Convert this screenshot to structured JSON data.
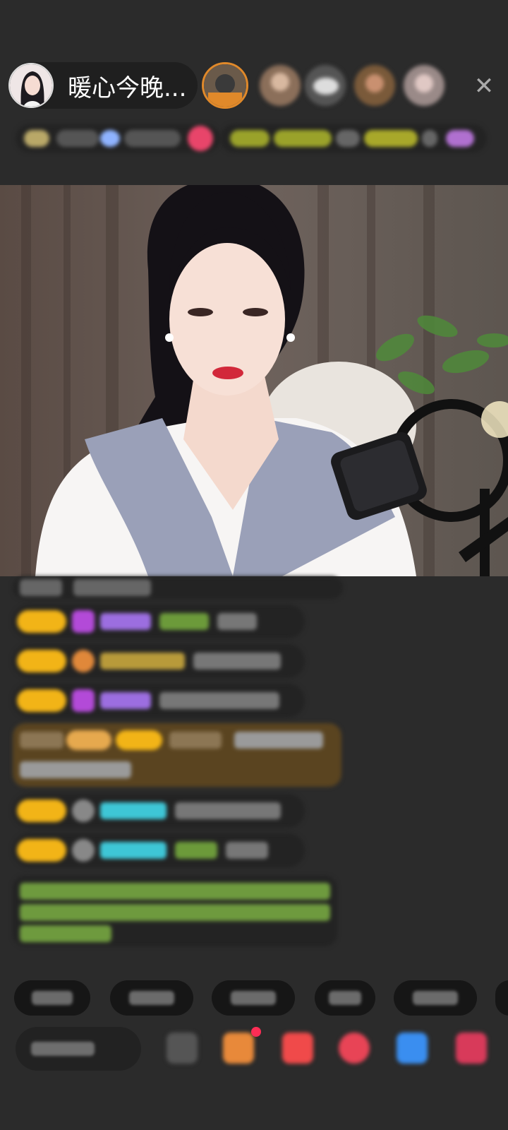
{
  "host": {
    "name": "暖心今晚...",
    "avatar_icon": "host-avatar"
  },
  "top_viewers": [
    "viewer-avatar-1",
    "viewer-avatar-2",
    "viewer-avatar-3",
    "viewer-avatar-4",
    "viewer-avatar-5"
  ],
  "close_icon": "close-icon",
  "colors": {
    "background": "#2b2b2b",
    "level_badge": "#f2b417",
    "highlight_msg": "#5a4420",
    "green_text": "#8bc34a",
    "cyan_name": "#3ec6d6"
  }
}
